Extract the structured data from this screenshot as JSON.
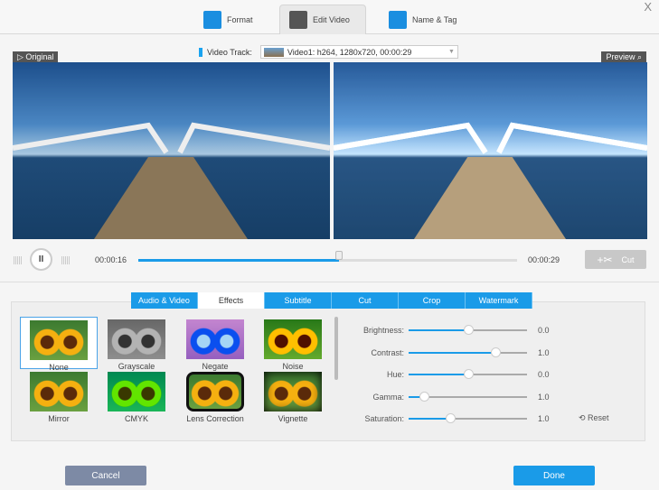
{
  "header": {
    "tabs": [
      {
        "label": "Format",
        "icon": "format-icon"
      },
      {
        "label": "Edit Video",
        "icon": "edit-video-icon"
      },
      {
        "label": "Name & Tag",
        "icon": "name-tag-icon"
      }
    ],
    "close": "X"
  },
  "track": {
    "label": "Video Track:",
    "value": "Video1: h264, 1280x720, 00:00:29"
  },
  "labels": {
    "original": "▷ Original",
    "preview": "Preview ⌕"
  },
  "player": {
    "current": "00:00:16",
    "total": "00:00:29",
    "progress": 0.53,
    "cut": "Cut"
  },
  "edit_tabs": [
    "Audio & Video",
    "Effects",
    "Subtitle",
    "Cut",
    "Crop",
    "Watermark"
  ],
  "effects": [
    "None",
    "Grayscale",
    "Negate",
    "Noise",
    "Mirror",
    "CMYK",
    "Lens Correction",
    "Vignette"
  ],
  "sliders": [
    {
      "name": "Brightness:",
      "value": "0.0",
      "pos": 0.5
    },
    {
      "name": "Contrast:",
      "value": "1.0",
      "pos": 0.73
    },
    {
      "name": "Hue:",
      "value": "0.0",
      "pos": 0.5
    },
    {
      "name": "Gamma:",
      "value": "1.0",
      "pos": 0.13
    },
    {
      "name": "Saturation:",
      "value": "1.0",
      "pos": 0.35
    }
  ],
  "reset": "⟲ Reset",
  "buttons": {
    "cancel": "Cancel",
    "done": "Done"
  },
  "colors": {
    "accent": "#1a9be8",
    "cancel": "#7d8aa5"
  }
}
